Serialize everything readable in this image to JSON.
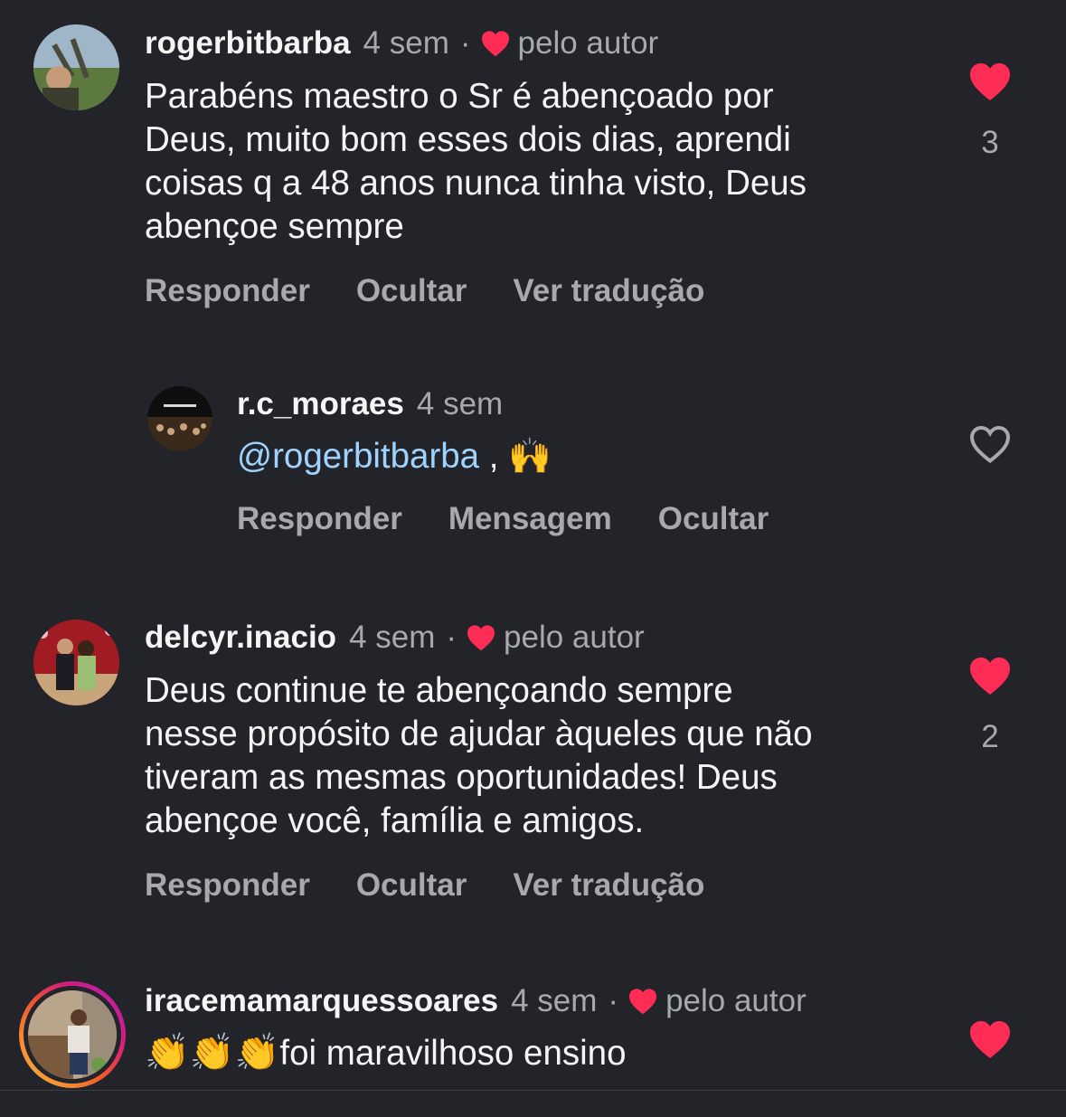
{
  "comments": [
    {
      "username": "rogerbitbarba",
      "time": "4 sem",
      "separator": "·",
      "by_author": "pelo autor",
      "text": "Parabéns maestro o Sr é abençoado por\nDeus, muito bom esses dois dias, aprendi\ncoisas q a 48 anos nunca tinha visto, Deus\nabençoe sempre",
      "liked": true,
      "like_count": "3",
      "actions": [
        "Responder",
        "Ocultar",
        "Ver tradução"
      ]
    },
    {
      "username": "r.c_moraes",
      "time": "4 sem",
      "mention": "@rogerbitbarba",
      "text_suffix": " , 🙌",
      "liked": false,
      "actions": [
        "Responder",
        "Mensagem",
        "Ocultar"
      ]
    },
    {
      "username": "delcyr.inacio",
      "time": "4 sem",
      "separator": "·",
      "by_author": "pelo autor",
      "text": "Deus continue te abençoando sempre\nnesse propósito de ajudar àqueles que não\ntiveram as mesmas oportunidades! Deus\nabençoe você, família e amigos.",
      "liked": true,
      "like_count": "2",
      "actions": [
        "Responder",
        "Ocultar",
        "Ver tradução"
      ]
    },
    {
      "username": "iracemamarquessoares",
      "time": "4 sem",
      "separator": "·",
      "by_author": "pelo autor",
      "emoji": "👏👏👏",
      "text": "foi maravilhoso ensino",
      "liked": true
    }
  ],
  "colors": {
    "background": "#22242a",
    "heart_red": "#ff2d55",
    "mention": "#9fd3ff",
    "muted": "#a8a9ad"
  }
}
